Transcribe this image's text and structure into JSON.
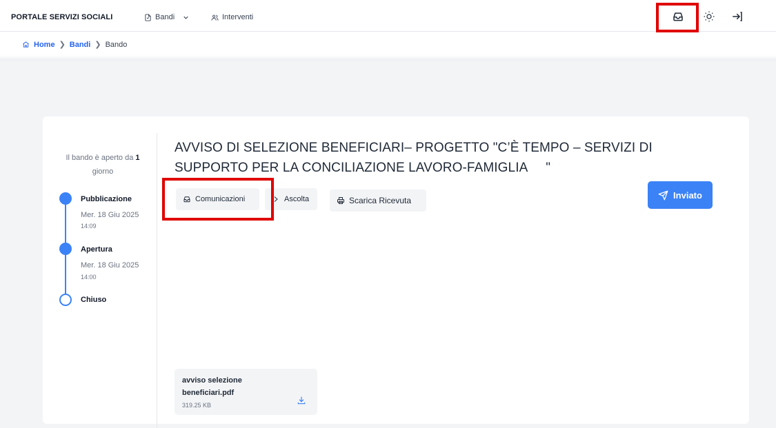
{
  "header": {
    "brand": "PORTALE SERVIZI SOCIALI",
    "nav": [
      {
        "label": "Bandi",
        "icon": "document-icon",
        "has_dropdown": true
      },
      {
        "label": "Interventi",
        "icon": "users-icon"
      }
    ],
    "actions": [
      "inbox-icon",
      "sun-icon",
      "logout-icon"
    ]
  },
  "breadcrumb": {
    "home": "Home",
    "bandi": "Bandi",
    "current": "Bando"
  },
  "sidebar": {
    "open_prefix": "Il bando è aperto da ",
    "open_days": "1",
    "open_suffix": "giorno",
    "timeline": [
      {
        "title": "Pubblicazione",
        "date": "Mer. 18 Giu 2025",
        "time": "14:09",
        "completed": true
      },
      {
        "title": "Apertura",
        "date": "Mer. 18 Giu 2025",
        "time": "14:00",
        "completed": true
      },
      {
        "title": "Chiuso",
        "completed": false
      }
    ]
  },
  "main": {
    "title_line1": "AVVISO DI SELEZIONE BENEFICIARI– PROGETTO \"C’È TEMPO – SERVIZI DI",
    "title_line2": "SUPPORTO PER LA CONCILIAZIONE LAVORO-FAMIGLIA     \"",
    "buttons": {
      "comunicazioni": "Comunicazioni",
      "ascolta": "Ascolta",
      "scarica": "Scarica Ricevuta",
      "inviato": "Inviato"
    },
    "attachment": {
      "name": "avviso selezione beneficiari.pdf",
      "size": "319.25 KB"
    }
  },
  "colors": {
    "accent": "#3b82f6",
    "link": "#2563eb",
    "highlight": "#e00000"
  }
}
